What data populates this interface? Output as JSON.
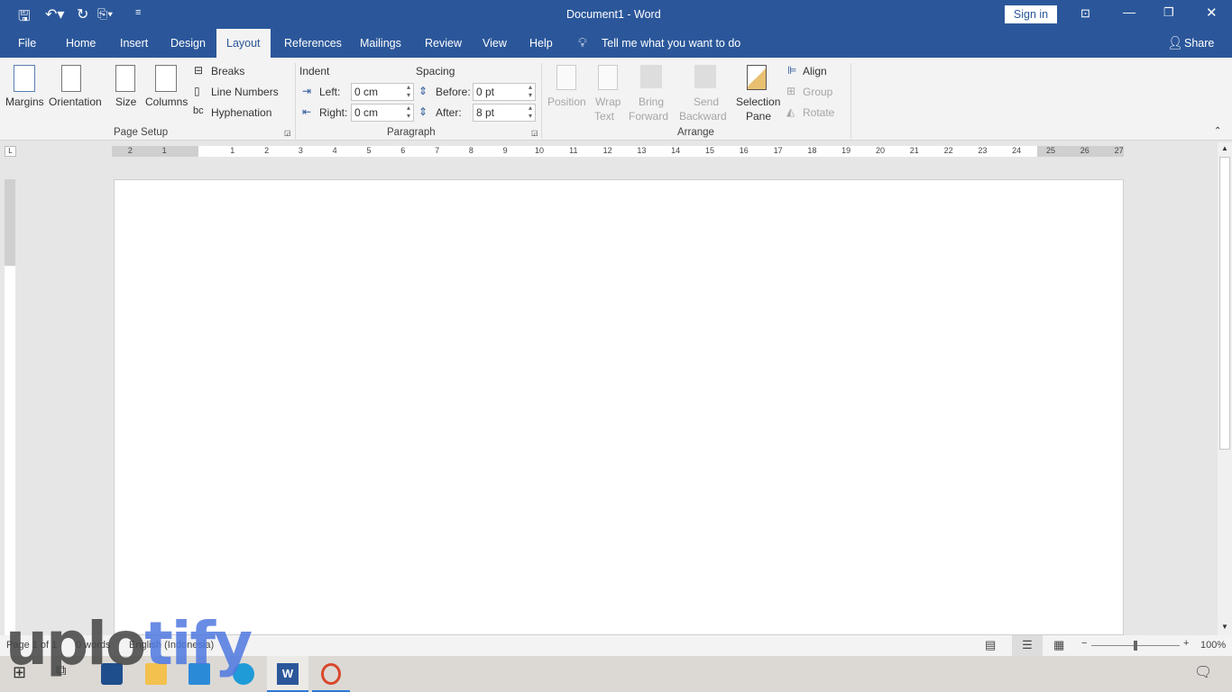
{
  "titlebar": {
    "title": "Document1  -  Word",
    "sign_in": "Sign in"
  },
  "tabs": [
    "File",
    "Home",
    "Insert",
    "Design",
    "Layout",
    "References",
    "Mailings",
    "Review",
    "View",
    "Help"
  ],
  "tell_me": "Tell me what you want to do",
  "share": "Share",
  "page_setup": {
    "margins": "Margins",
    "orientation": "Orientation",
    "size": "Size",
    "columns": "Columns",
    "breaks": "Breaks",
    "line_numbers": "Line Numbers",
    "hyphenation": "Hyphenation",
    "group": "Page Setup"
  },
  "paragraph": {
    "indent": "Indent",
    "spacing": "Spacing",
    "left_label": "Left:",
    "left_value": "0 cm",
    "right_label": "Right:",
    "right_value": "0 cm",
    "before_label": "Before:",
    "before_value": "0 pt",
    "after_label": "After:",
    "after_value": "8 pt",
    "group": "Paragraph"
  },
  "arrange": {
    "position": "Position",
    "wrap1": "Wrap",
    "wrap2": "Text",
    "bring1": "Bring",
    "bring2": "Forward",
    "send1": "Send",
    "send2": "Backward",
    "sel1": "Selection",
    "sel2": "Pane",
    "align": "Align",
    "group_btn": "Group",
    "rotate": "Rotate",
    "group": "Arrange"
  },
  "ruler": [
    "2",
    "1",
    "1",
    "2",
    "3",
    "4",
    "5",
    "6",
    "7",
    "8",
    "9",
    "10",
    "11",
    "12",
    "13",
    "14",
    "15",
    "16",
    "17",
    "18",
    "19",
    "20",
    "21",
    "22",
    "23",
    "24",
    "25",
    "26",
    "27"
  ],
  "status": {
    "page": "Page 1 of 1",
    "words": "0 words",
    "language": "English (Indonesia)",
    "zoom": "100%"
  },
  "watermark": {
    "part1": "uplo",
    "part2": "tify"
  },
  "colors": {
    "brand": "#2b579a"
  }
}
